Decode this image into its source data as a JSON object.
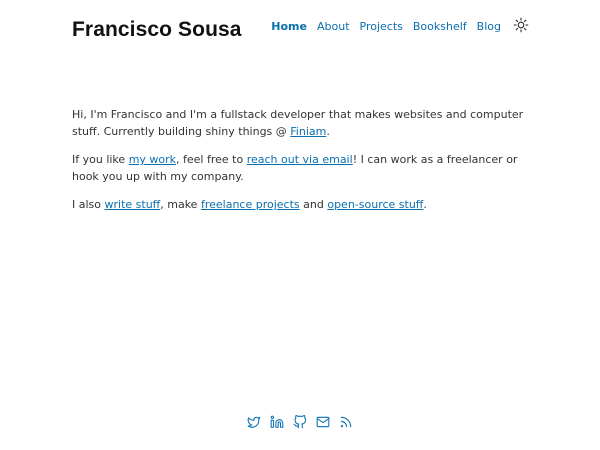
{
  "header": {
    "site_title": "Francisco Sousa",
    "nav": [
      {
        "label": "Home",
        "active": true
      },
      {
        "label": "About",
        "active": false
      },
      {
        "label": "Projects",
        "active": false
      },
      {
        "label": "Bookshelf",
        "active": false
      },
      {
        "label": "Blog",
        "active": false
      }
    ],
    "theme_toggle_icon": "sun-icon"
  },
  "intro": {
    "p1_text_1": "Hi, I'm Francisco and I'm a fullstack developer that makes websites and computer stuff. Currently building shiny things @ ",
    "p1_link": "Finiam",
    "p1_text_2": ".",
    "p2_text_1": "If you like ",
    "p2_link_1": "my work",
    "p2_text_2": ", feel free to ",
    "p2_link_2": "reach out via email",
    "p2_text_3": "! I can work as a freelancer or hook you up with my company.",
    "p3_text_1": "I also ",
    "p3_link_1": "write stuff",
    "p3_text_2": ", make ",
    "p3_link_2": "freelance projects",
    "p3_text_3": " and ",
    "p3_link_3": "open-source stuff",
    "p3_text_4": "."
  },
  "footer": {
    "social_icons": [
      "twitter-icon",
      "linkedin-icon",
      "github-icon",
      "mail-icon",
      "rss-icon"
    ]
  },
  "colors": {
    "link": "#0a6fb0",
    "text": "#333333",
    "title": "#111111",
    "background": "#ffffff"
  }
}
